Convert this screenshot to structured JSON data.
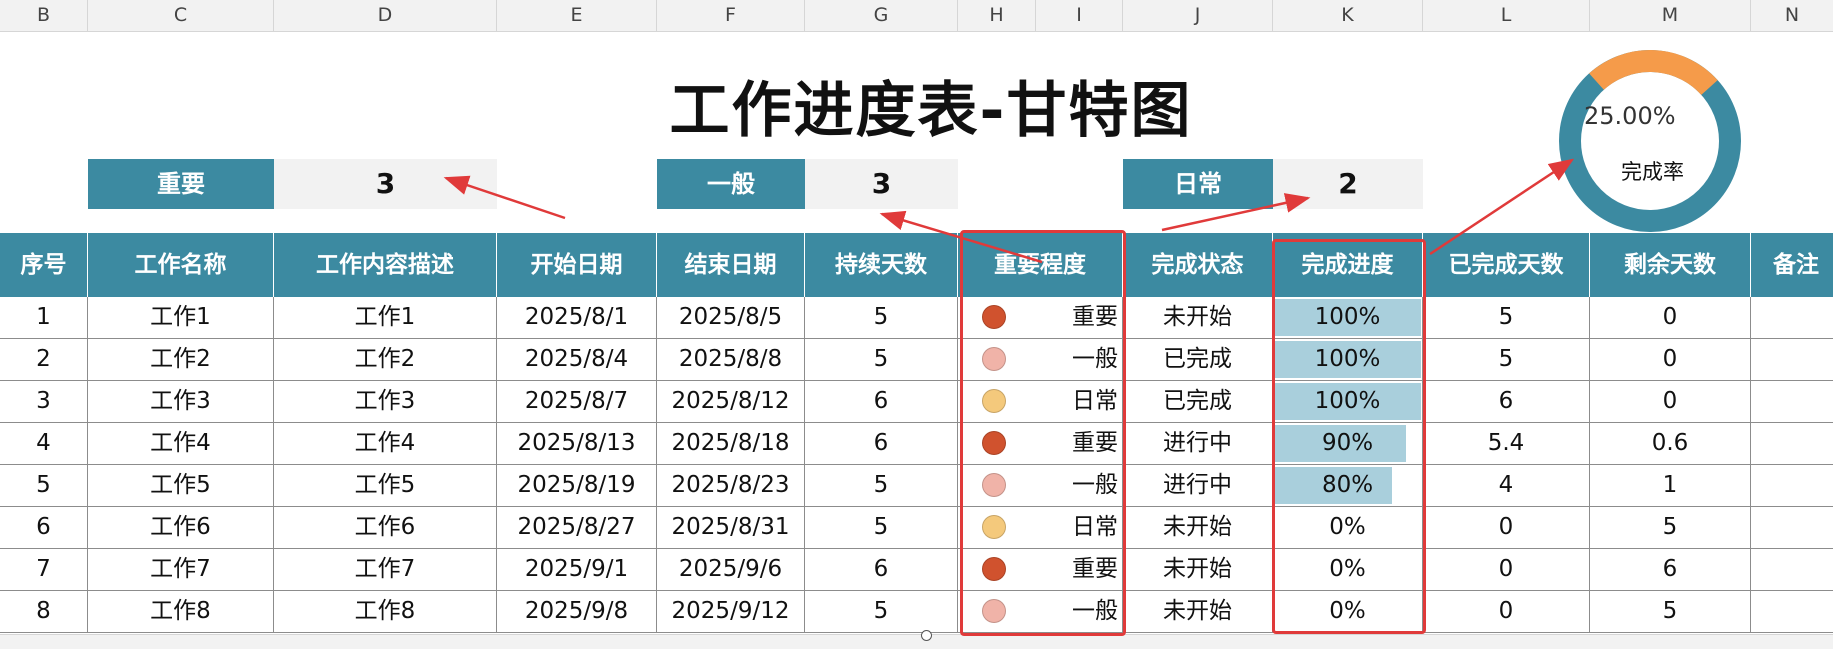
{
  "columns": [
    "B",
    "C",
    "D",
    "E",
    "F",
    "G",
    "H",
    "I",
    "J",
    "K",
    "L",
    "M",
    "N"
  ],
  "title": "工作进度表-甘特图",
  "summary": [
    {
      "label": "重要",
      "value": "3"
    },
    {
      "label": "一般",
      "value": "3"
    },
    {
      "label": "日常",
      "value": "2"
    }
  ],
  "donut": {
    "percent_text": "25.00%",
    "caption": "完成率",
    "percent": 25.0,
    "filled_color": "#f59b4a",
    "track_color": "#3c8aa1"
  },
  "headers": [
    "序号",
    "工作名称",
    "工作内容描述",
    "开始日期",
    "结束日期",
    "持续天数",
    "重要程度",
    "完成状态",
    "完成进度",
    "已完成天数",
    "剩余天数",
    "备注"
  ],
  "colors": {
    "header_bg": "#3c8aa1",
    "bar": "#a9cfdc",
    "重要": "#d0522e",
    "一般": "#f0b3a8",
    "日常": "#f4c97c",
    "annotation": "#e03a3a"
  },
  "rows": [
    {
      "no": "1",
      "name": "工作1",
      "desc": "工作1",
      "start": "2025/8/1",
      "end": "2025/8/5",
      "days": "5",
      "level": "重要",
      "status": "未开始",
      "progress": "100%",
      "progress_value": 100,
      "done": "5",
      "remain": "0"
    },
    {
      "no": "2",
      "name": "工作2",
      "desc": "工作2",
      "start": "2025/8/4",
      "end": "2025/8/8",
      "days": "5",
      "level": "一般",
      "status": "已完成",
      "progress": "100%",
      "progress_value": 100,
      "done": "5",
      "remain": "0"
    },
    {
      "no": "3",
      "name": "工作3",
      "desc": "工作3",
      "start": "2025/8/7",
      "end": "2025/8/12",
      "days": "6",
      "level": "日常",
      "status": "已完成",
      "progress": "100%",
      "progress_value": 100,
      "done": "6",
      "remain": "0"
    },
    {
      "no": "4",
      "name": "工作4",
      "desc": "工作4",
      "start": "2025/8/13",
      "end": "2025/8/18",
      "days": "6",
      "level": "重要",
      "status": "进行中",
      "progress": "90%",
      "progress_value": 90,
      "done": "5.4",
      "remain": "0.6"
    },
    {
      "no": "5",
      "name": "工作5",
      "desc": "工作5",
      "start": "2025/8/19",
      "end": "2025/8/23",
      "days": "5",
      "level": "一般",
      "status": "进行中",
      "progress": "80%",
      "progress_value": 80,
      "done": "4",
      "remain": "1"
    },
    {
      "no": "6",
      "name": "工作6",
      "desc": "工作6",
      "start": "2025/8/27",
      "end": "2025/8/31",
      "days": "5",
      "level": "日常",
      "status": "未开始",
      "progress": "0%",
      "progress_value": 0,
      "done": "0",
      "remain": "5"
    },
    {
      "no": "7",
      "name": "工作7",
      "desc": "工作7",
      "start": "2025/9/1",
      "end": "2025/9/6",
      "days": "6",
      "level": "重要",
      "status": "未开始",
      "progress": "0%",
      "progress_value": 0,
      "done": "0",
      "remain": "6"
    },
    {
      "no": "8",
      "name": "工作8",
      "desc": "工作8",
      "start": "2025/9/8",
      "end": "2025/9/12",
      "days": "5",
      "level": "一般",
      "status": "未开始",
      "progress": "0%",
      "progress_value": 0,
      "done": "0",
      "remain": "5"
    }
  ]
}
